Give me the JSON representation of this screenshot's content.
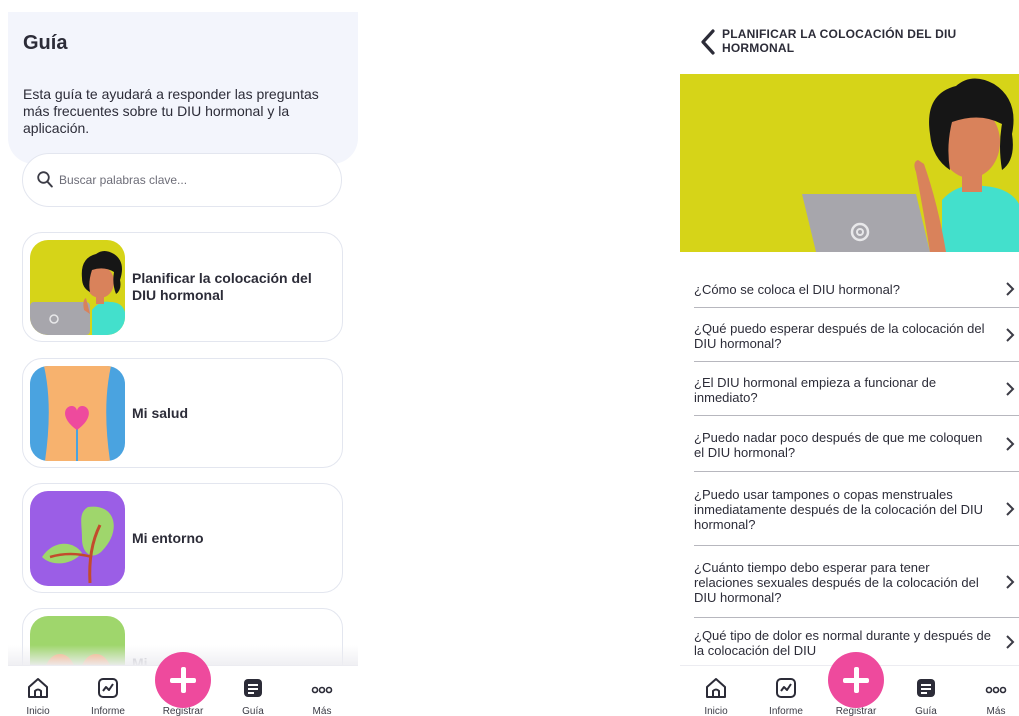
{
  "left": {
    "title": "Guía",
    "description": "Esta guía te ayudará a responder las preguntas más frecuentes sobre tu DIU hormonal y la aplicación.",
    "search_placeholder": "Buscar palabras clave...",
    "cards": [
      {
        "label": "Planificar la colocación del DIU hormonal"
      },
      {
        "label": "Mi salud"
      },
      {
        "label": "Mi entorno"
      },
      {
        "label": "Mi"
      }
    ]
  },
  "right": {
    "title": "PLANIFICAR LA COLOCACIÓN DEL DIU HORMONAL",
    "questions": [
      {
        "text": "¿Cómo se coloca el DIU hormonal?"
      },
      {
        "text": "¿Qué puedo esperar después de la colocación del DIU hormonal?"
      },
      {
        "text": "¿El DIU hormonal empieza a funcionar de inmediato?"
      },
      {
        "text": "¿Puedo nadar poco después de que me coloquen el DIU hormonal?"
      },
      {
        "text": "¿Puedo usar tampones o copas menstruales inmediatamente después de la colocación del DIU hormonal?"
      },
      {
        "text": "¿Cuánto tiempo debo esperar para tener relaciones sexuales después de la colocación del DIU hormonal?"
      },
      {
        "text": "¿Qué tipo de dolor es normal durante y después de la colocación del DIU"
      }
    ]
  },
  "nav": {
    "tabs": [
      {
        "label": "Inicio",
        "icon": "home-icon"
      },
      {
        "label": "Informe",
        "icon": "chart-icon"
      },
      {
        "label": "Registrar",
        "icon": "plus-icon"
      },
      {
        "label": "Guía",
        "icon": "document-icon"
      },
      {
        "label": "Más",
        "icon": "more-icon"
      }
    ]
  },
  "colors": {
    "accent_pink": "#ee4a9d",
    "hero_yellow": "#d6d418",
    "header_bg": "#f3f5fc",
    "card_purple": "#9b5ee6",
    "card_blue": "#4aa3e0",
    "card_teal": "#3fe0c8"
  }
}
